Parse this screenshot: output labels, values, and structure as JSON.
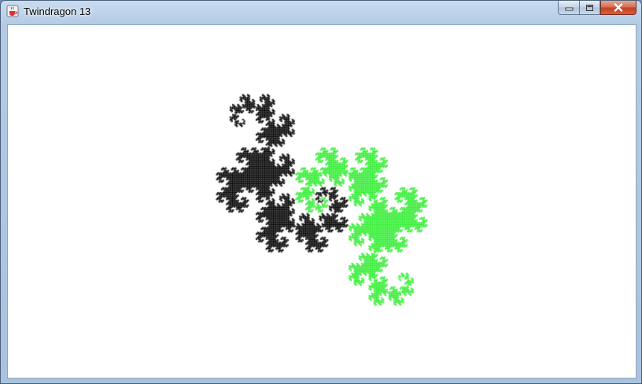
{
  "window": {
    "title": "Twindragon 13",
    "app_icon": "java-cup-icon",
    "controls": {
      "minimize_icon": "minimize-icon",
      "maximize_icon": "maximize-icon",
      "close_icon": "close-icon"
    }
  },
  "fractal": {
    "order": 13,
    "colors": {
      "dragon_a": "#000000",
      "dragon_b": "#33ee33",
      "background": "#ffffff"
    }
  }
}
